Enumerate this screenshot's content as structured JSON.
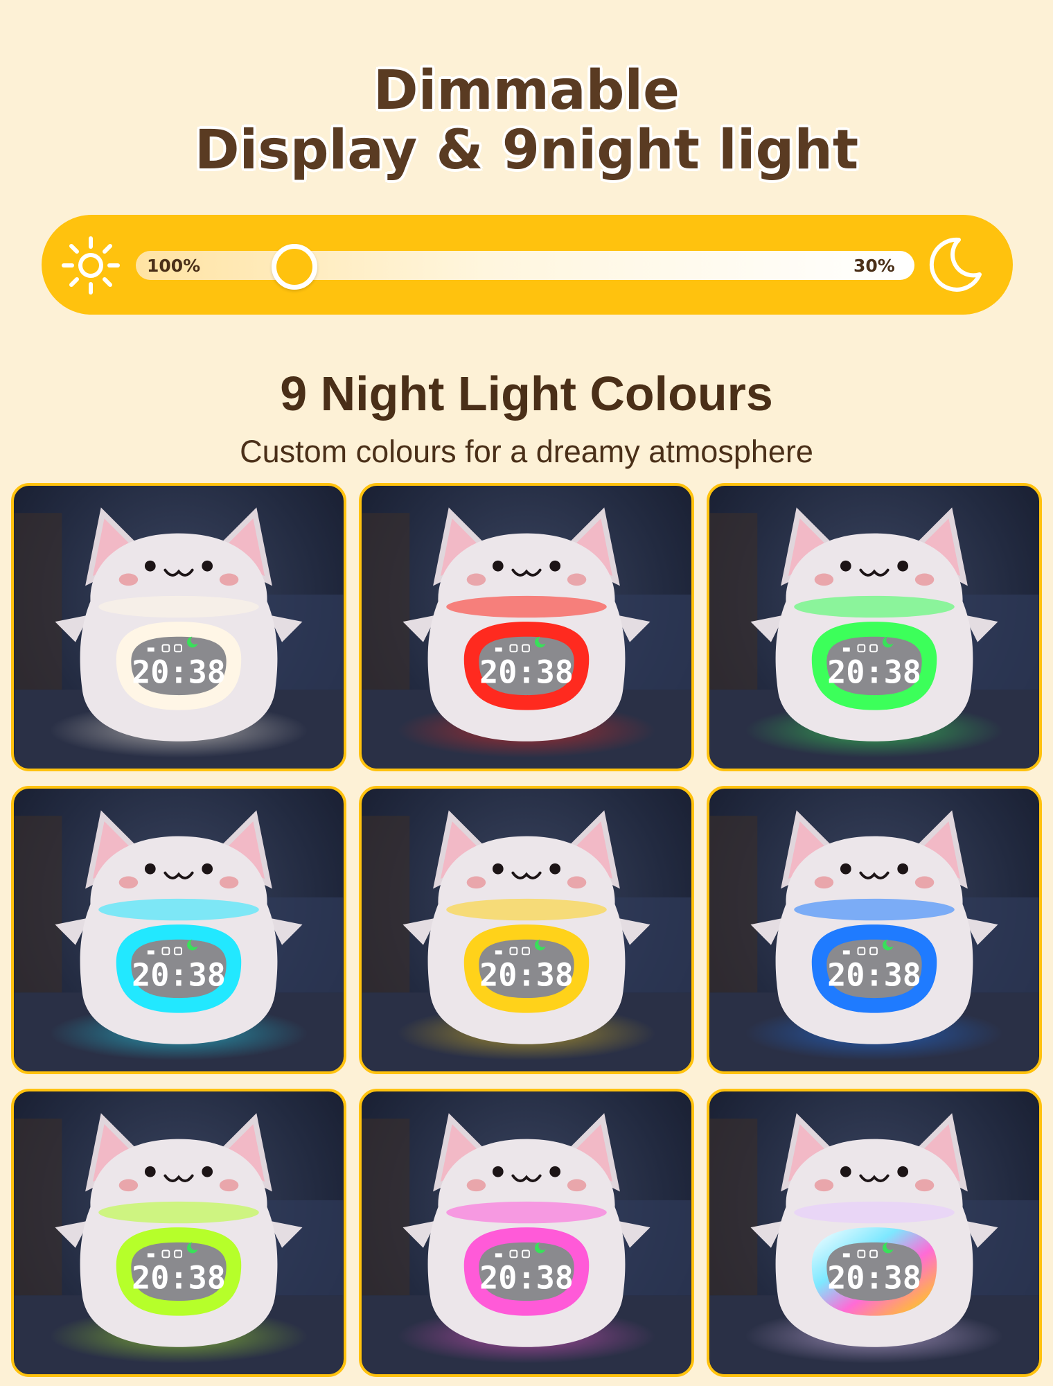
{
  "headline": {
    "line1": "Dimmable",
    "line2": "Display & 9night light"
  },
  "brightness": {
    "max_label": "100%",
    "min_label": "30%",
    "left_icon": "sun-icon",
    "right_icon": "moon-icon"
  },
  "colours_section": {
    "title": "9 Night Light Colours",
    "subtitle": "Custom colours for a dreamy atmosphere"
  },
  "clock_time": "20:38",
  "night_lights": [
    {
      "color": "#fff6e6",
      "glow": "#ffe9b8"
    },
    {
      "color": "#ff2a1f",
      "glow": "#ffb2a6"
    },
    {
      "color": "#3cff5a",
      "glow": "#d8ffb8"
    },
    {
      "color": "#22e8ff",
      "glow": "#c8f6ff"
    },
    {
      "color": "#ffd21a",
      "glow": "#fff0a6"
    },
    {
      "color": "#1f7bff",
      "glow": "#dbe7ff"
    },
    {
      "color": "#b6ff2a",
      "glow": "#f3ffb8"
    },
    {
      "color": "#ff5ad8",
      "glow": "#ffd0f0"
    },
    {
      "color": "rainbow",
      "glow": "#f4e8ff"
    }
  ]
}
